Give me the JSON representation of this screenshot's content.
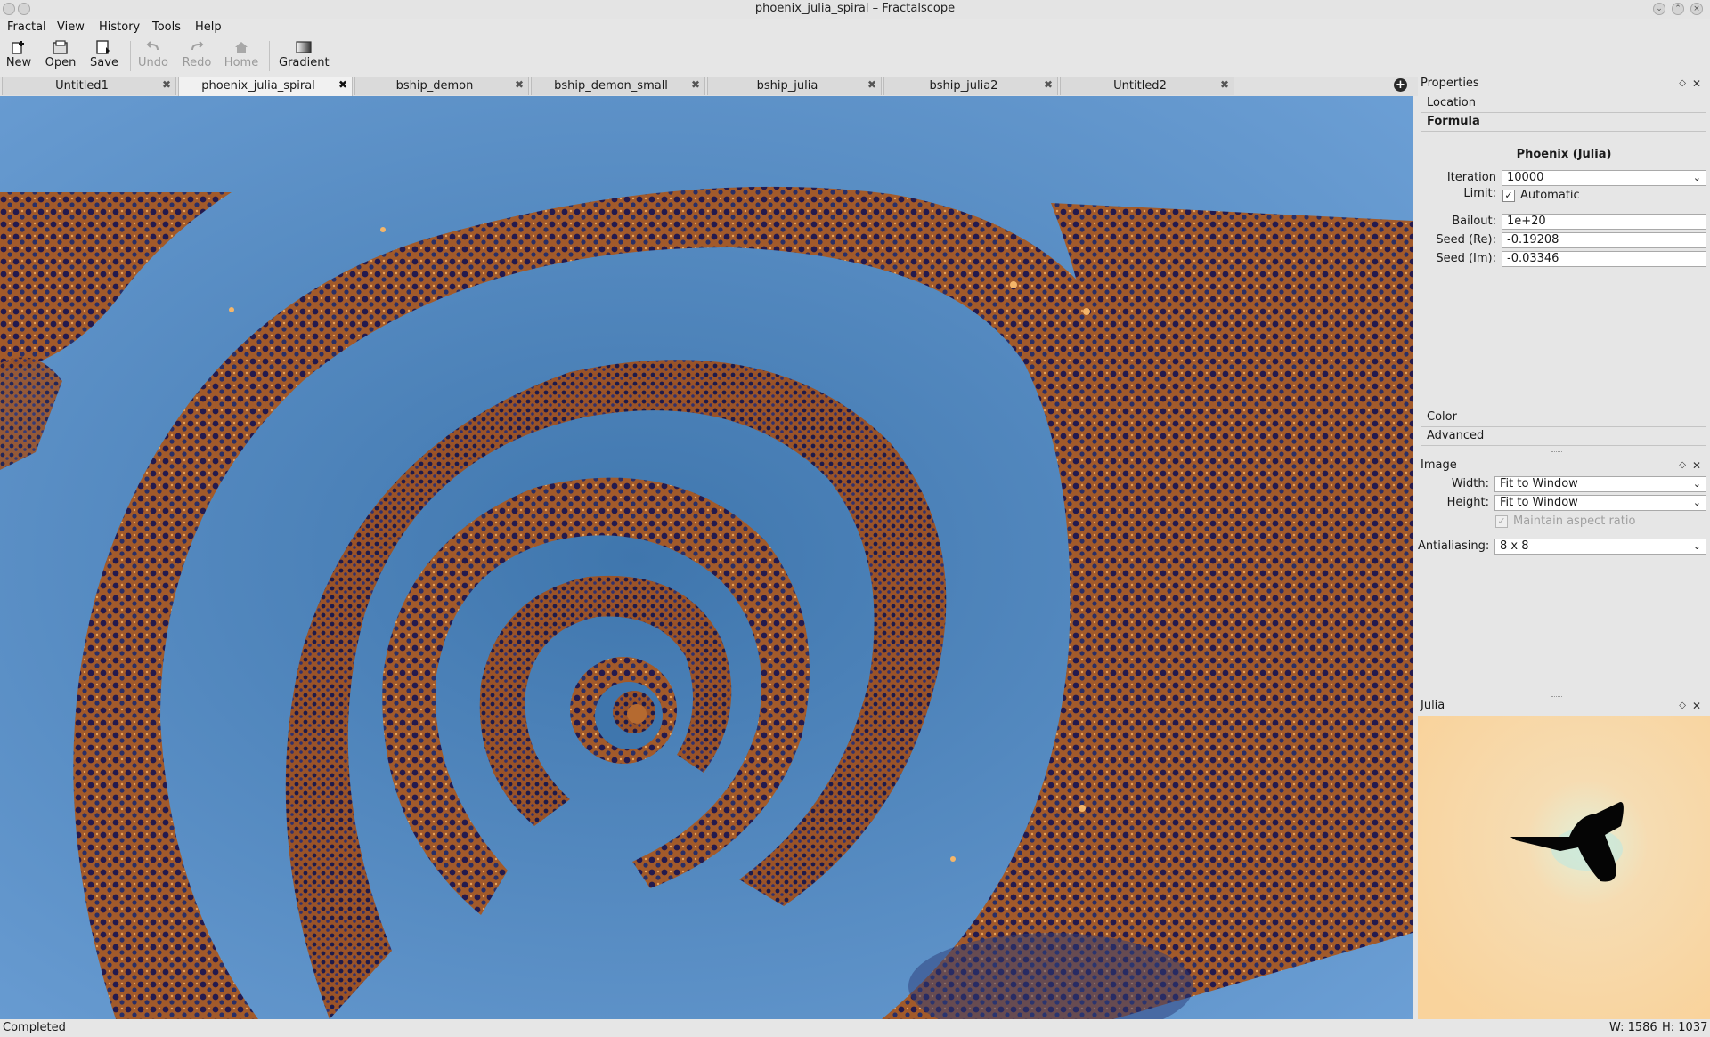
{
  "window": {
    "title": "phoenix_julia_spiral – Fractalscope"
  },
  "menu": [
    "Fractal",
    "View",
    "History",
    "Tools",
    "Help"
  ],
  "toolbar": {
    "new": "New",
    "open": "Open",
    "save": "Save",
    "undo": "Undo",
    "redo": "Redo",
    "home": "Home",
    "gradient": "Gradient"
  },
  "tabs": [
    {
      "label": "Untitled1",
      "active": false
    },
    {
      "label": "phoenix_julia_spiral",
      "active": true
    },
    {
      "label": "bship_demon",
      "active": false
    },
    {
      "label": "bship_demon_small",
      "active": false
    },
    {
      "label": "bship_julia",
      "active": false
    },
    {
      "label": "bship_julia2",
      "active": false
    },
    {
      "label": "Untitled2",
      "active": false
    }
  ],
  "properties": {
    "title": "Properties",
    "sections": {
      "location": "Location",
      "formula": "Formula",
      "color": "Color",
      "advanced": "Advanced"
    },
    "formula_name": "Phoenix (Julia)",
    "iteration_limit_label": "Iteration Limit:",
    "iteration_limit_value": "10000",
    "automatic_label": "Automatic",
    "automatic_checked": true,
    "bailout_label": "Bailout:",
    "bailout_value": "1e+20",
    "seed_re_label": "Seed (Re):",
    "seed_re_value": "-0.19208",
    "seed_im_label": "Seed (Im):",
    "seed_im_value": "-0.03346"
  },
  "image_panel": {
    "title": "Image",
    "width_label": "Width:",
    "width_value": "Fit to Window",
    "height_label": "Height:",
    "height_value": "Fit to Window",
    "maintain_aspect_label": "Maintain aspect ratio",
    "antialiasing_label": "Antialiasing:",
    "antialiasing_value": "8 x 8"
  },
  "julia_panel": {
    "title": "Julia"
  },
  "status": {
    "text": "Completed",
    "width": "W: 1586",
    "height": "H: 1037"
  },
  "colors": {
    "sky_blue": "#5f95cf",
    "band_orange": "#a0582a",
    "dark_navy": "#1b1b4a",
    "julia_bg": "#f9d49f"
  }
}
